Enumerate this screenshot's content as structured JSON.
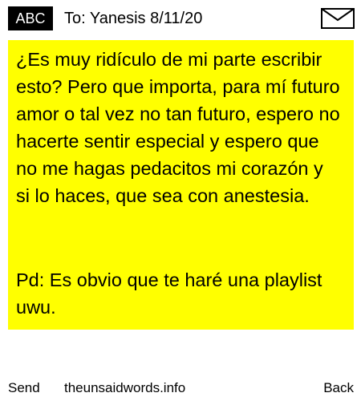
{
  "header": {
    "badge_label": "ABC",
    "recipient": "To: Yanesis 8/11/20",
    "envelope_icon": "envelope-icon"
  },
  "note": {
    "background_color": "#ffff00",
    "paragraph_1": "¿Es muy ridículo de mi parte escribir esto? Pero que importa, para mí futuro amor o tal vez no tan futuro, espero no hacerte sentir especial y espero que no me hagas pedacitos mi corazón y si lo haces, que sea con anestesia.",
    "paragraph_2": "Pd: Es obvio que te haré una playlist uwu."
  },
  "footer": {
    "send_label": "Send",
    "site_label": "theunsaidwords.info",
    "back_label": "Back"
  }
}
